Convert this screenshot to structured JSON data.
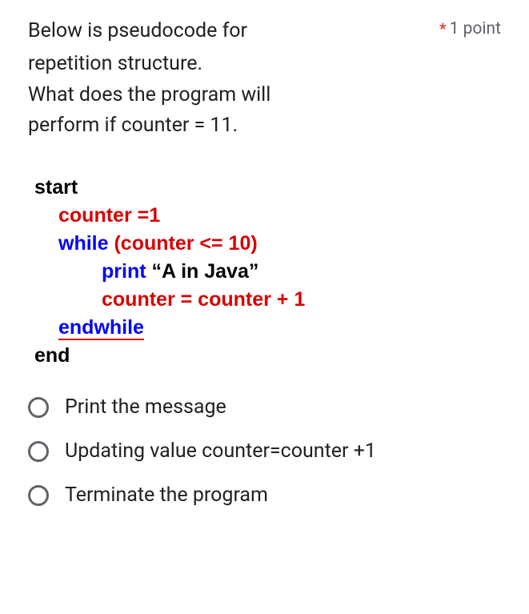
{
  "question": {
    "line1": "Below is pseudocode for",
    "line2": "repetition structure.",
    "line3": "What does the program will",
    "line4": "perform if counter = 11."
  },
  "required_mark": "*",
  "points": "1 point",
  "code": {
    "l1": "start",
    "l2": "counter =1",
    "l3a": "while ",
    "l3b": "(counter <= 10)",
    "l4a": "print ",
    "l4b": "“A in Java”",
    "l5": "counter = counter + 1",
    "l6": "endwhile",
    "l7": "end"
  },
  "options": [
    {
      "label": "Print the message"
    },
    {
      "label": "Updating value counter=counter +1"
    },
    {
      "label": "Terminate the program"
    }
  ]
}
